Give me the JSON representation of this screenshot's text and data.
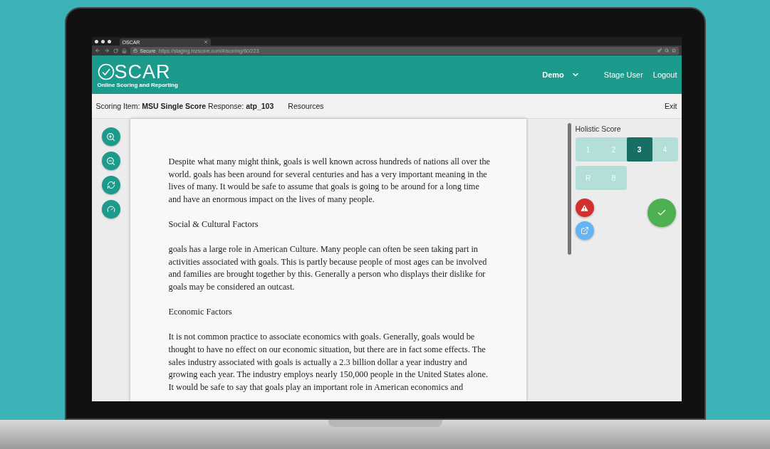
{
  "browser": {
    "tab_title": "OSCAR",
    "security": "Secure",
    "url": "https://staging.mzscore.com/#/scoring/60/223"
  },
  "header": {
    "logo_text": "SCAR",
    "tagline": "Online Scoring and Reporting",
    "user_menu": "Demo",
    "links": [
      "Stage User",
      "Logout"
    ]
  },
  "toolbar": {
    "title": "Scoring Item: **MSU Single Score** Response: **atp_103**",
    "resources": "Resources",
    "exit": "Exit"
  },
  "document": {
    "paragraphs": [
      "Despite what many might think, goals is well known across hundreds of nations all over the world. goals has been around for several centuries and has a very important meaning in the lives of many. It would be safe to assume that goals is going to be around for a long time and have an enormous impact on the lives of many people.",
      "Social & Cultural Factors",
      "goals has a large role in American Culture. Many people can often be seen taking part in activities associated with goals. This is partly because people of most ages can be involved and families are brought together by this. Generally a person who displays their dislike for goals may be considered an outcast.",
      "Economic Factors",
      "It is not common practice to associate economics with goals. Generally, goals would be thought to have no effect on our economic situation, but there are in fact some effects. The sales industry associated with goals is actually a 2.3 billion dollar a year industry and growing each year. The industry employs nearly 150,000 people in the United States alone. It would be safe to say that goals play an important role in American economics and"
    ]
  },
  "score_panel": {
    "title": "Holistic Score",
    "scores": [
      {
        "label": "1",
        "selected": false
      },
      {
        "label": "2",
        "selected": false
      },
      {
        "label": "3",
        "selected": true
      },
      {
        "label": "4",
        "selected": false
      }
    ],
    "codes": [
      {
        "label": "R",
        "selected": false
      },
      {
        "label": "B",
        "selected": false
      }
    ]
  }
}
